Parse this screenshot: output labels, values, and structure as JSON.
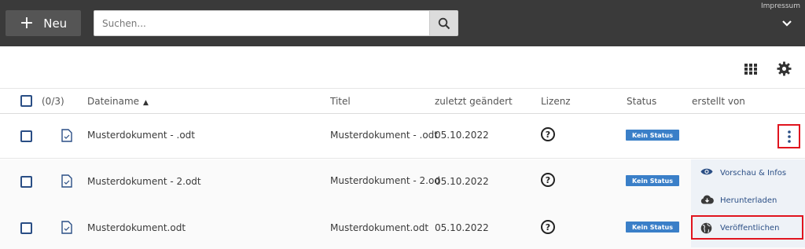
{
  "topbar": {
    "new_label": "Neu",
    "search_placeholder": "Suchen...",
    "impressum": "Impressum"
  },
  "table": {
    "selection_count": "(0/3)",
    "headers": {
      "filename": "Dateiname",
      "title": "Titel",
      "modified": "zuletzt geändert",
      "license": "Lizenz",
      "status": "Status",
      "created_by": "erstellt von"
    },
    "rows": [
      {
        "filename": "Musterdokument - .odt",
        "title": "Musterdokument - .odt",
        "modified": "05.10.2022",
        "license": "?",
        "status": "Kein Status"
      },
      {
        "filename": "Musterdokument - 2.odt",
        "title": "Musterdokument - 2.od",
        "modified": "05.10.2022",
        "license": "?",
        "status": "Kein Status"
      },
      {
        "filename": "Musterdokument.odt",
        "title": "Musterdokument.odt",
        "modified": "05.10.2022",
        "license": "?",
        "status": "Kein Status"
      }
    ]
  },
  "context_menu": {
    "preview": "Vorschau & Infos",
    "download": "Herunterladen",
    "publish": "Veröffentlichen"
  },
  "colors": {
    "topbar": "#3a3a3a",
    "accent": "#2a4e85",
    "badge": "#3a7fc8",
    "highlight": "#e0141e"
  }
}
